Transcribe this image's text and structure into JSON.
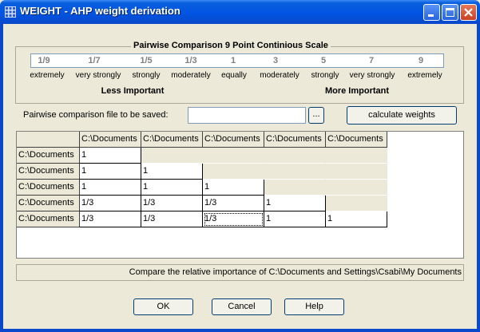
{
  "window": {
    "title": "WEIGHT - AHP weight derivation"
  },
  "scale": {
    "title": "Pairwise Comparison 9 Point Continious Scale",
    "values": [
      "1/9",
      "1/7",
      "1/5",
      "1/3",
      "1",
      "3",
      "5",
      "7",
      "9"
    ],
    "labels": [
      "extremely",
      "very strongly",
      "strongly",
      "moderately",
      "equally",
      "moderately",
      "strongly",
      "very strongly",
      "extremely"
    ],
    "less": "Less Important",
    "more": "More Important"
  },
  "file": {
    "label": "Pairwise comparison file to be saved:",
    "value": "",
    "browse": "...",
    "calculate": "calculate weights"
  },
  "matrix": {
    "headers": [
      "C:\\Documents",
      "C:\\Documents",
      "C:\\Documents",
      "C:\\Documents",
      "C:\\Documents"
    ],
    "rows": [
      {
        "label": "C:\\Documents",
        "cells": [
          "1",
          "",
          "",
          "",
          ""
        ]
      },
      {
        "label": "C:\\Documents",
        "cells": [
          "1",
          "1",
          "",
          "",
          ""
        ]
      },
      {
        "label": "C:\\Documents",
        "cells": [
          "1",
          "1",
          "1",
          "",
          ""
        ]
      },
      {
        "label": "C:\\Documents",
        "cells": [
          "1/3",
          "1/3",
          "1/3",
          "1",
          ""
        ]
      },
      {
        "label": "C:\\Documents",
        "cells": [
          "1/3",
          "1/3",
          "1/3",
          "1",
          "1"
        ]
      }
    ]
  },
  "status": "Compare the relative importance of C:\\Documents and Settings\\Csabi\\My Documents",
  "buttons": {
    "ok": "OK",
    "cancel": "Cancel",
    "help": "Help"
  }
}
